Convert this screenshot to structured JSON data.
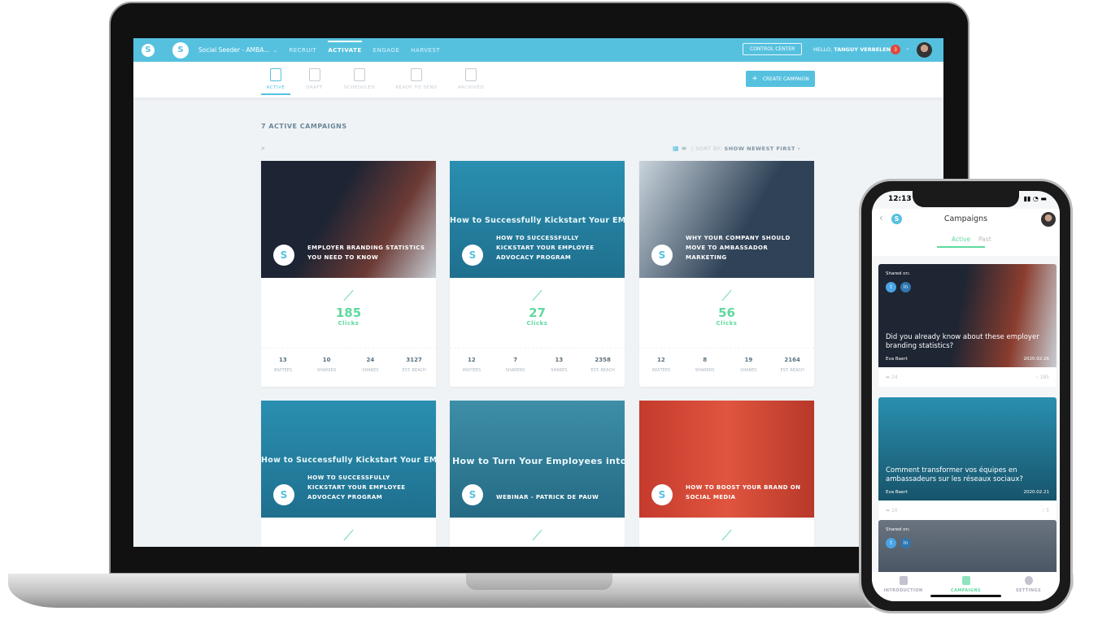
{
  "app": {
    "workspace": "Social Seeder - AMBA...",
    "nav": [
      "RECRUIT",
      "ACTIVATE",
      "ENGAGE",
      "HARVEST"
    ],
    "active_nav": "ACTIVATE",
    "control_center": "CONTROL CENTER",
    "hello": "HELLO,",
    "user": "TANGUY VERBELEN",
    "notifications": "3"
  },
  "tabs": [
    "ACTIVE",
    "DRAFT",
    "SCHEDULED",
    "READY TO SEND",
    "ARCHIVED"
  ],
  "create_label": "CREATE CAMPAIGN",
  "count_label": "7 ACTIVE CAMPAIGNS",
  "sort": {
    "label": "SORT BY:",
    "value": "SHOW NEWEST FIRST"
  },
  "stat_labels": [
    "INVITEES",
    "SHARERS",
    "SHARES",
    "EST. REACH"
  ],
  "clicks_label": "Clicks",
  "cards": [
    {
      "title": "EMPLOYER BRANDING STATISTICS YOU NEED TO KNOW",
      "banner": "",
      "clicks": "185",
      "stats": [
        "13",
        "10",
        "24",
        "3127"
      ]
    },
    {
      "title": "HOW TO SUCCESSFULLY KICKSTART YOUR EMPLOYEE ADVOCACY PROGRAM",
      "banner": "How to Successfully Kickstart Your EMPLOYEE ADVOCACY PROGRAM",
      "clicks": "27",
      "stats": [
        "12",
        "7",
        "13",
        "2358"
      ]
    },
    {
      "title": "WHY YOUR COMPANY SHOULD MOVE TO AMBASSADOR MARKETING",
      "banner": "",
      "clicks": "56",
      "stats": [
        "12",
        "8",
        "19",
        "2164"
      ]
    },
    {
      "title": "HOW TO SUCCESSFULLY KICKSTART YOUR EMPLOYEE ADVOCACY PROGRAM",
      "banner": "How to Successfully Kickstart Your EMPLOYEE ADVOCACY PROGRAM"
    },
    {
      "title": "WEBINAR - PATRICK DE PAUW",
      "banner": "How to Turn Your Employees into Ambassadors"
    },
    {
      "title": "HOW TO BOOST YOUR BRAND ON SOCIAL MEDIA",
      "banner": ""
    }
  ],
  "phone": {
    "time": "12:13",
    "title": "Campaigns",
    "tabs": [
      "Active",
      "Past"
    ],
    "shared_on": "Shared on:",
    "posts": [
      {
        "title": "Did you already know about these employer branding statistics?",
        "author": "Eva Baert",
        "date": "2020.02.26",
        "shares": "24",
        "clicks": "185"
      },
      {
        "title": "Comment transformer vos équipes en ambassadeurs sur les réseaux sociaux?",
        "author": "Eva Baert",
        "date": "2020.02.21",
        "shares": "10",
        "clicks": "5"
      }
    ],
    "bottom_tabs": [
      "INTRODUCTION",
      "CAMPAIGNS",
      "SETTINGS"
    ]
  },
  "colors": {
    "primary": "#56c1df",
    "accent": "#5fd9a0",
    "badge": "#e2463b"
  }
}
